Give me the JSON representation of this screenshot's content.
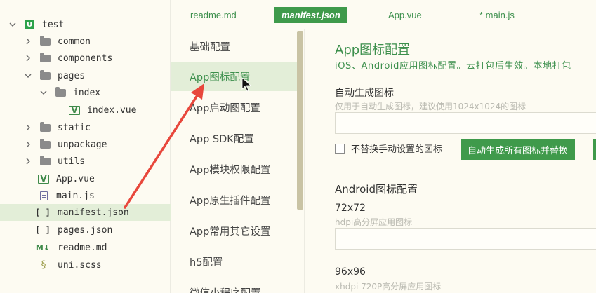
{
  "tree": {
    "root": "test",
    "items": [
      {
        "label": "common"
      },
      {
        "label": "components"
      },
      {
        "label": "pages"
      },
      {
        "label": "index"
      },
      {
        "label": "index.vue"
      },
      {
        "label": "static"
      },
      {
        "label": "unpackage"
      },
      {
        "label": "utils"
      },
      {
        "label": "App.vue"
      },
      {
        "label": "main.js"
      },
      {
        "label": "manifest.json"
      },
      {
        "label": "pages.json"
      },
      {
        "label": "readme.md"
      },
      {
        "label": "uni.scss"
      }
    ],
    "icons": {
      "vue": "V",
      "bracket": "[ ]",
      "md": "M↓",
      "root": "U",
      "scss": "§"
    }
  },
  "tabs": [
    {
      "label": "readme.md"
    },
    {
      "label": "manifest.json"
    },
    {
      "label": "App.vue"
    },
    {
      "label": "* main.js"
    }
  ],
  "nav": {
    "items": [
      {
        "label": "基础配置"
      },
      {
        "label": "App图标配置"
      },
      {
        "label": "App启动图配置"
      },
      {
        "label": "App SDK配置"
      },
      {
        "label": "App模块权限配置"
      },
      {
        "label": "App原生插件配置"
      },
      {
        "label": "App常用其它设置"
      },
      {
        "label": "h5配置"
      },
      {
        "label": "微信小程序配置"
      }
    ]
  },
  "content": {
    "title": "App图标配置",
    "desc": "iOS、Android应用图标配置。云打包后生效。本地打包",
    "auto_label": "自动生成图标",
    "auto_hint": "仅用于自动生成图标，建议使用1024x1024的图标",
    "checkbox_label": "不替换手动设置的图标",
    "gen_button": "自动生成所有图标并替换",
    "android_title": "Android图标配置",
    "size_72": "72x72",
    "hint_72": "hdpi高分屏应用图标",
    "size_96": "96x96",
    "hint_96": "xhdpi 720P高分屏应用图标"
  },
  "colors": {
    "accent": "#3f9a4b",
    "accent_text": "#3c8f4c",
    "selected_bg": "#e3eed8",
    "background": "#fdfbf2",
    "annotation_arrow": "#e8473c"
  }
}
